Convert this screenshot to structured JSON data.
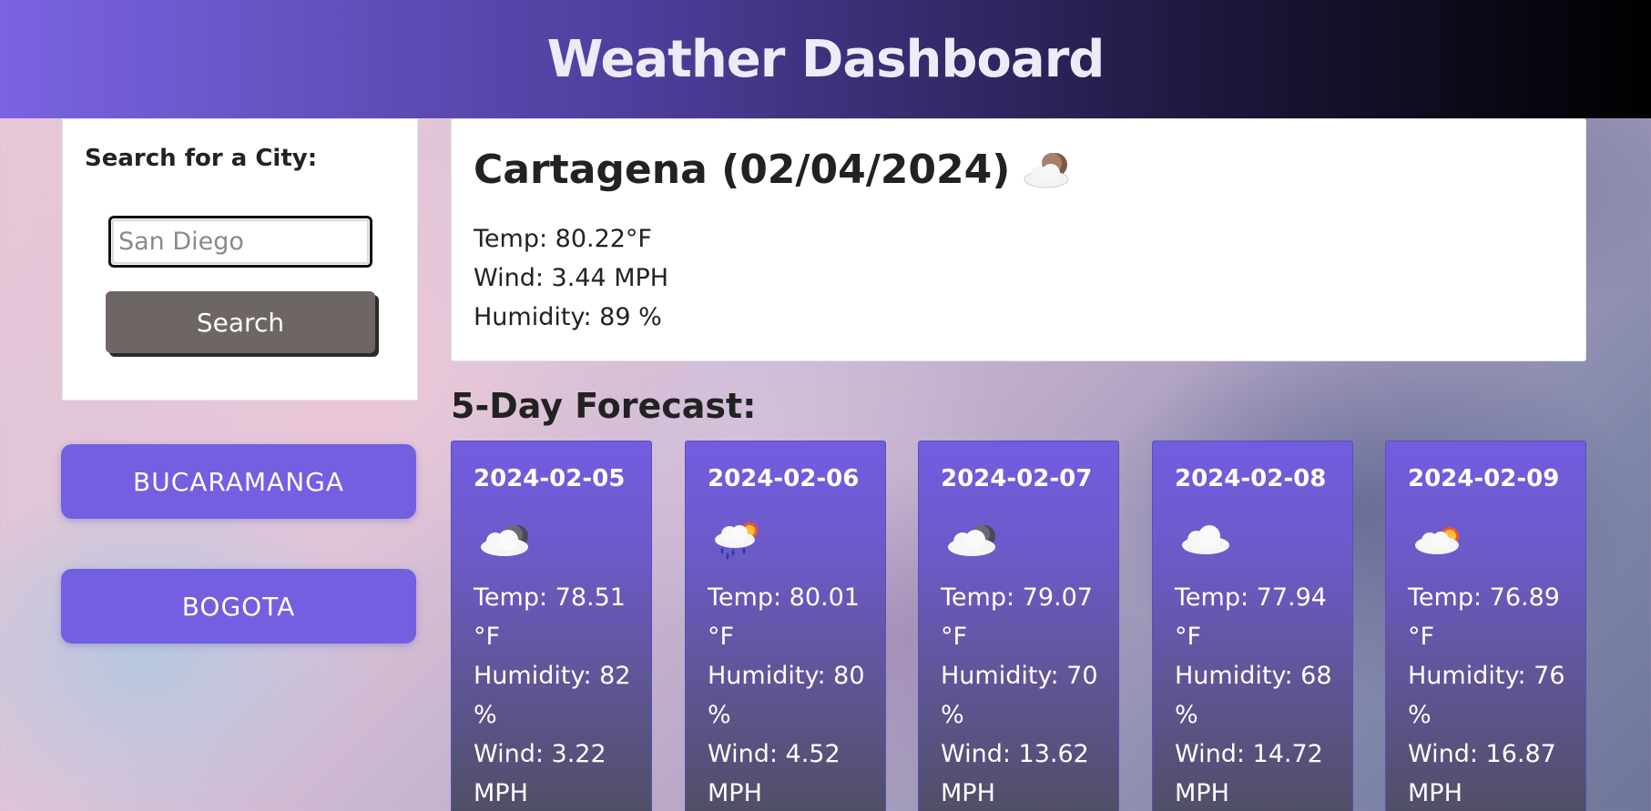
{
  "header": {
    "title": "Weather Dashboard"
  },
  "search": {
    "label": "Search for a City:",
    "placeholder": "San Diego",
    "button_label": "Search"
  },
  "history": [
    "BUCARAMANGA",
    "BOGOTA"
  ],
  "current": {
    "title": "Cartagena (02/04/2024)",
    "icon": "cloud-moon-icon",
    "temp": "Temp: 80.22°F",
    "wind": "Wind: 3.44 MPH",
    "humidity": "Humidity: 89 %"
  },
  "forecast": {
    "heading": "5-Day Forecast:",
    "days": [
      {
        "date": "2024-02-05",
        "icon": "cloud-moon-icon",
        "temp_a": "Temp: 78.51",
        "temp_b": "°F",
        "hum_a": "Humidity: 82",
        "hum_b": "%",
        "wind_a": "Wind: 3.22",
        "wind_b": "MPH"
      },
      {
        "date": "2024-02-06",
        "icon": "rain-sun-icon",
        "temp_a": "Temp: 80.01",
        "temp_b": "°F",
        "hum_a": "Humidity: 80",
        "hum_b": "%",
        "wind_a": "Wind: 4.52",
        "wind_b": "MPH"
      },
      {
        "date": "2024-02-07",
        "icon": "cloud-moon-icon",
        "temp_a": "Temp: 79.07",
        "temp_b": "°F",
        "hum_a": "Humidity: 70",
        "hum_b": "%",
        "wind_a": "Wind: 13.62",
        "wind_b": "MPH"
      },
      {
        "date": "2024-02-08",
        "icon": "cloud-icon",
        "temp_a": "Temp: 77.94",
        "temp_b": "°F",
        "hum_a": "Humidity: 68",
        "hum_b": "%",
        "wind_a": "Wind: 14.72",
        "wind_b": "MPH"
      },
      {
        "date": "2024-02-09",
        "icon": "cloud-sun-icon",
        "temp_a": "Temp: 76.89",
        "temp_b": "°F",
        "hum_a": "Humidity: 76",
        "hum_b": "%",
        "wind_a": "Wind: 16.87",
        "wind_b": "MPH"
      }
    ]
  },
  "colors": {
    "accent": "#7260e0",
    "search_button": "#6e6665"
  }
}
